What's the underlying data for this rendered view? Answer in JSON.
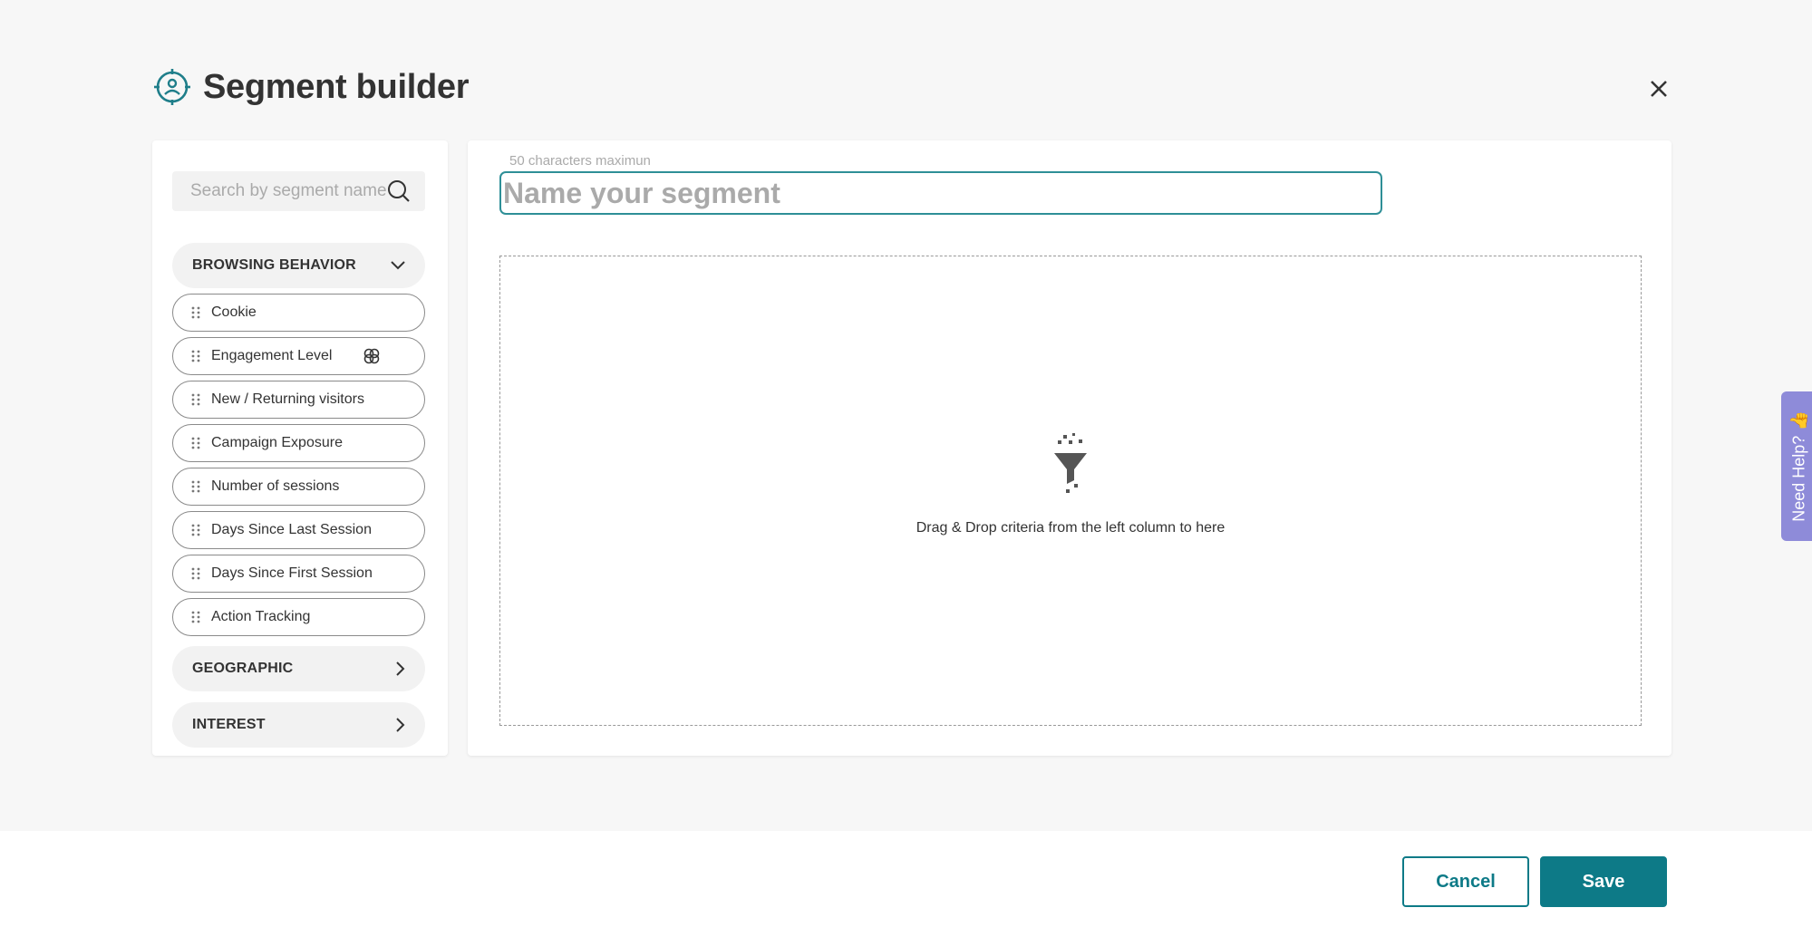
{
  "header": {
    "title": "Segment builder",
    "icon": "segment-target-icon"
  },
  "search": {
    "placeholder": "Search by segment name"
  },
  "categories": {
    "browsing": {
      "label": "BROWSING BEHAVIOR",
      "expanded": true
    },
    "geographic": {
      "label": "GEOGRAPHIC",
      "expanded": false
    },
    "interest": {
      "label": "INTEREST",
      "expanded": false
    }
  },
  "criteria": [
    {
      "label": "Cookie"
    },
    {
      "label": "Engagement Level",
      "icon": "ai-badge-icon"
    },
    {
      "label": "New / Returning visitors"
    },
    {
      "label": "Campaign Exposure"
    },
    {
      "label": "Number of sessions"
    },
    {
      "label": "Days Since Last Session"
    },
    {
      "label": "Days Since First Session"
    },
    {
      "label": "Action Tracking"
    }
  ],
  "segment": {
    "hint": "50 characters maximun",
    "placeholder": "Name your segment",
    "value": ""
  },
  "dropzone": {
    "text": "Drag & Drop criteria from the left column to here",
    "icon": "funnel-icon"
  },
  "help": {
    "label": "Need Help? 👍"
  },
  "footer": {
    "cancel_label": "Cancel",
    "save_label": "Save"
  },
  "colors": {
    "accent": "#0d7a87",
    "help": "#8e8bd9",
    "input_border": "#2e8f97"
  }
}
